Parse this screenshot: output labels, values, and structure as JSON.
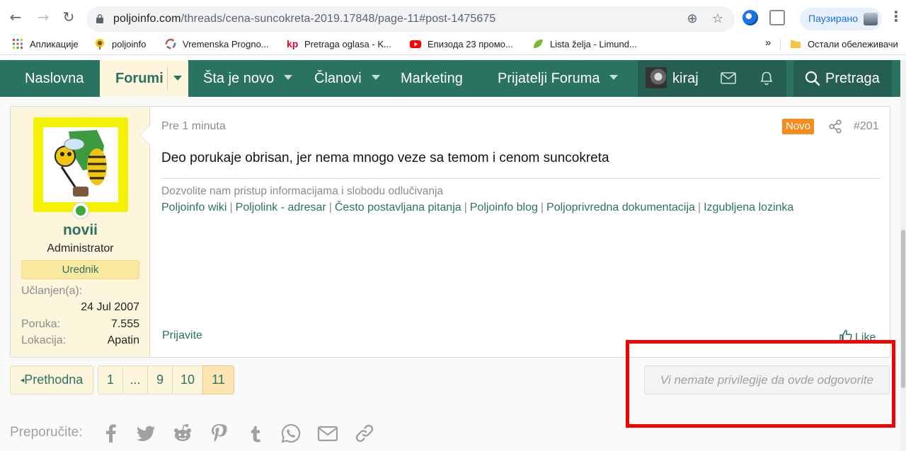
{
  "browser": {
    "url_domain": "poljoinfo.com",
    "url_path": "/threads/cena-suncokreta-2019.17848/page-11#post-1475675",
    "profile_label": "Паузирано",
    "bookmarks": [
      {
        "label": "Апликације",
        "icon": "apps-grid-icon"
      },
      {
        "label": "poljoinfo",
        "icon": "sunflower-icon"
      },
      {
        "label": "Vremenska Progno...",
        "icon": "weather-ring-icon"
      },
      {
        "label": "Pretraga oglasa - K...",
        "icon": "kp-logo-icon"
      },
      {
        "label": "Епизода 23 промо...",
        "icon": "youtube-icon"
      },
      {
        "label": "Lista želja - Limund...",
        "icon": "leaf-icon"
      }
    ],
    "other_bookmarks": "Остали обележивачи",
    "overflow": "»"
  },
  "nav": {
    "home": "Naslovna",
    "forums": "Forumi",
    "whats_new": "Šta je novo",
    "members": "Članovi",
    "marketing": "Marketing",
    "friends": "Prijatelji Foruma",
    "username": "kiraj",
    "search": "Pretraga"
  },
  "post": {
    "time": "Pre 1 minuta",
    "new_badge": "Novo",
    "number": "#201",
    "body": "Deo porukaje obrisan, jer nema mnogo veze sa temom i cenom suncokreta",
    "signature_tagline": "Dozvolite nam pristup informacijama i slobodu odlučivanja",
    "signature_links": [
      "Poljoinfo wiki",
      "Poljolink - adresar",
      "Često postavljana pitanja",
      "Poljoinfo blog",
      "Poljoprivredna dokumentacija",
      "Izgubljena lozinka"
    ],
    "report": "Prijavite",
    "like": "Like",
    "author": {
      "name": "novii",
      "role": "Administrator",
      "badge": "Urednik",
      "joined_label": "Učlanjen(a):",
      "joined_value": "24 Jul 2007",
      "posts_label": "Poruka:",
      "posts_value": "7.555",
      "location_label": "Lokacija:",
      "location_value": "Apatin"
    }
  },
  "pagination": {
    "prev": "Prethodna",
    "pages": [
      "1",
      "...",
      "9",
      "10",
      "11"
    ],
    "current": "11"
  },
  "no_reply": "Vi nemate privilegije da ovde odgovorite",
  "share": {
    "label": "Preporučite:",
    "icons": [
      "facebook-icon",
      "twitter-icon",
      "reddit-icon",
      "pinterest-icon",
      "tumblr-icon",
      "whatsapp-icon",
      "email-icon",
      "link-icon"
    ]
  },
  "colors": {
    "brand_green": "#2a7361",
    "highlight_red": "#f40000",
    "new_badge_orange": "#f78c1e",
    "user_panel": "#fdf6dd"
  }
}
